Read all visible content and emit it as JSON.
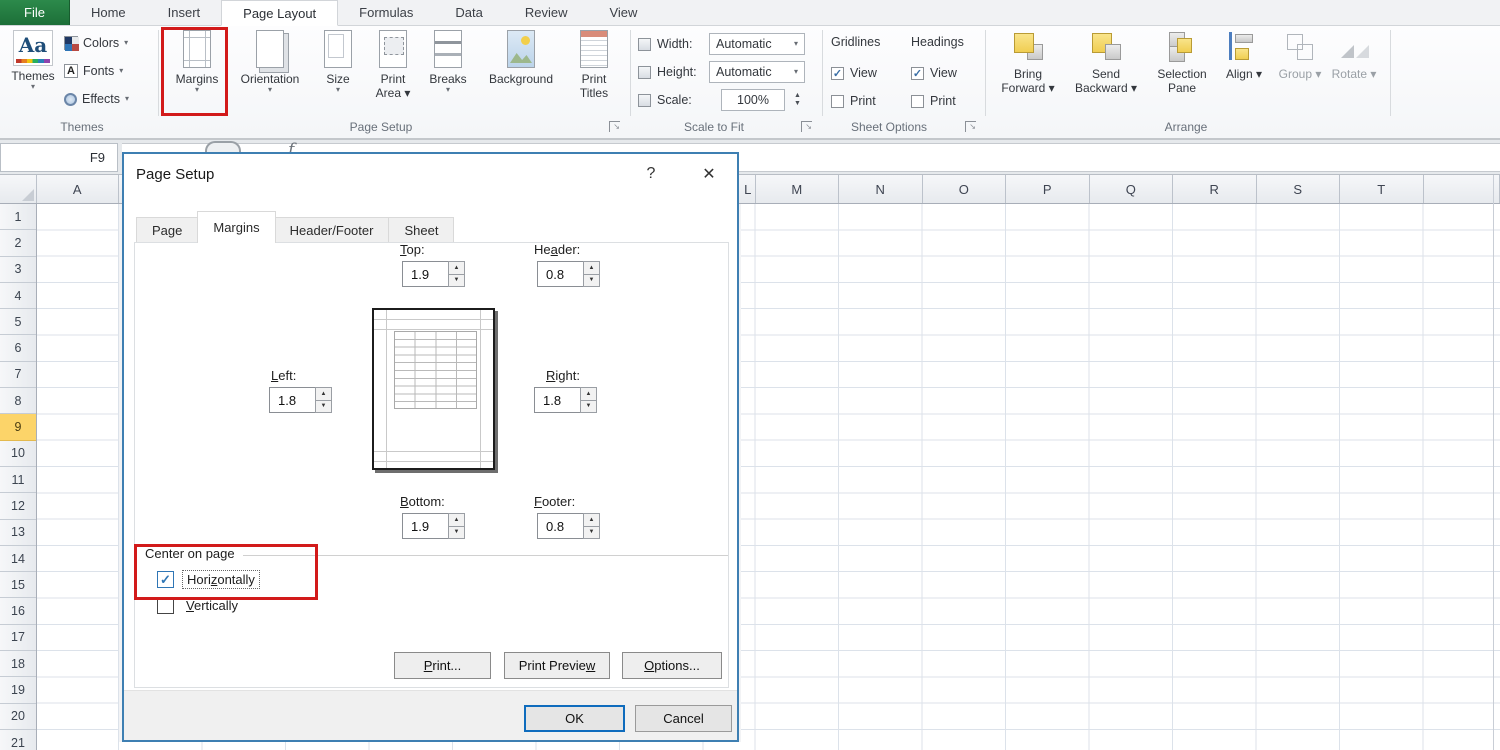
{
  "ribbon": {
    "tabs": [
      {
        "id": "file",
        "label": "File",
        "active": false
      },
      {
        "id": "home",
        "label": "Home",
        "active": false
      },
      {
        "id": "insert",
        "label": "Insert",
        "active": false
      },
      {
        "id": "page-layout",
        "label": "Page Layout",
        "active": true
      },
      {
        "id": "formulas",
        "label": "Formulas",
        "active": false
      },
      {
        "id": "data",
        "label": "Data",
        "active": false
      },
      {
        "id": "review",
        "label": "Review",
        "active": false
      },
      {
        "id": "view",
        "label": "View",
        "active": false
      }
    ],
    "themes": {
      "group_label": "Themes",
      "big_button": "Themes",
      "items": [
        {
          "id": "colors",
          "label": "Colors"
        },
        {
          "id": "fonts",
          "label": "Fonts"
        },
        {
          "id": "effects",
          "label": "Effects"
        }
      ]
    },
    "page_setup": {
      "group_label": "Page Setup",
      "buttons": [
        {
          "id": "margins",
          "lines": [
            "Margins"
          ],
          "caret": "below"
        },
        {
          "id": "orientation",
          "lines": [
            "Orientation"
          ],
          "caret": "below"
        },
        {
          "id": "size",
          "lines": [
            "Size"
          ],
          "caret": "below"
        },
        {
          "id": "print-area",
          "lines": [
            "Print",
            "Area"
          ],
          "caret": "inline"
        },
        {
          "id": "breaks",
          "lines": [
            "Breaks"
          ],
          "caret": "below"
        },
        {
          "id": "background",
          "lines": [
            "Background"
          ],
          "caret": "none"
        },
        {
          "id": "print-titles",
          "lines": [
            "Print",
            "Titles"
          ],
          "caret": "none"
        }
      ]
    },
    "scale_to_fit": {
      "group_label": "Scale to Fit",
      "rows": [
        {
          "id": "width",
          "label": "Width:",
          "value": "Automatic",
          "control": "dropdown"
        },
        {
          "id": "height",
          "label": "Height:",
          "value": "Automatic",
          "control": "dropdown"
        },
        {
          "id": "scale",
          "label": "Scale:",
          "value": "100%",
          "control": "spinner"
        }
      ]
    },
    "sheet_options": {
      "group_label": "Sheet Options",
      "columns": [
        {
          "id": "gridlines",
          "header": "Gridlines",
          "view": {
            "label": "View",
            "checked": true
          },
          "print": {
            "label": "Print",
            "checked": false
          }
        },
        {
          "id": "headings",
          "header": "Headings",
          "view": {
            "label": "View",
            "checked": true
          },
          "print": {
            "label": "Print",
            "checked": false
          }
        }
      ]
    },
    "arrange": {
      "group_label": "Arrange",
      "buttons": [
        {
          "id": "bring-forward",
          "lines": [
            "Bring",
            "Forward"
          ],
          "caret": true,
          "disabled": false
        },
        {
          "id": "send-backward",
          "lines": [
            "Send",
            "Backward"
          ],
          "caret": true,
          "disabled": false
        },
        {
          "id": "selection-pane",
          "lines": [
            "Selection",
            "Pane"
          ],
          "caret": false,
          "disabled": false
        },
        {
          "id": "align",
          "lines": [
            "Align"
          ],
          "caret": true,
          "disabled": false
        },
        {
          "id": "group",
          "lines": [
            "Group"
          ],
          "caret": true,
          "disabled": true
        },
        {
          "id": "rotate",
          "lines": [
            "Rotate"
          ],
          "caret": true,
          "disabled": true
        }
      ]
    }
  },
  "formula_bar": {
    "name_box_value": "F9"
  },
  "grid": {
    "col_a": "A",
    "right_columns": [
      "L",
      "M",
      "N",
      "O",
      "P",
      "Q",
      "R",
      "S",
      "T"
    ],
    "rows": [
      "1",
      "2",
      "3",
      "4",
      "5",
      "6",
      "7",
      "8",
      "9",
      "10",
      "11",
      "12",
      "13",
      "14",
      "15",
      "16",
      "17",
      "18",
      "19",
      "20",
      "21"
    ],
    "selected_row": "9"
  },
  "dialog": {
    "title": "Page Setup",
    "help": "?",
    "close": "✕",
    "tabs": [
      {
        "label": "Page",
        "active": false
      },
      {
        "label": "Margins",
        "active": true
      },
      {
        "label": "Header/Footer",
        "active": false
      },
      {
        "label": "Sheet",
        "active": false
      }
    ],
    "fields": {
      "top": {
        "pre": "",
        "key": "T",
        "post": "op:",
        "value": "1.9"
      },
      "header": {
        "pre": "He",
        "key": "a",
        "post": "der:",
        "value": "0.8"
      },
      "left": {
        "pre": "",
        "key": "L",
        "post": "eft:",
        "value": "1.8"
      },
      "right": {
        "pre": "",
        "key": "R",
        "post": "ight:",
        "value": "1.8"
      },
      "bottom": {
        "pre": "",
        "key": "B",
        "post": "ottom:",
        "value": "1.9"
      },
      "footer": {
        "pre": "",
        "key": "F",
        "post": "ooter:",
        "value": "0.8"
      }
    },
    "center_on_page": {
      "legend": "Center on page",
      "horizontally": {
        "pre": "Hori",
        "key": "z",
        "post": "ontally",
        "checked": true
      },
      "vertically": {
        "pre": "",
        "key": "V",
        "post": "ertically",
        "checked": false
      }
    },
    "buttons": {
      "print": {
        "pre": "",
        "key": "P",
        "post": "rint..."
      },
      "preview": {
        "pre": "Print Previe",
        "key": "w",
        "post": ""
      },
      "options": {
        "pre": "",
        "key": "O",
        "post": "ptions..."
      },
      "ok": "OK",
      "cancel": "Cancel"
    }
  },
  "colors": {
    "annotation_red": "#d21a1a",
    "file_tab_green": "#237b3f",
    "dialog_border": "#3e7fb2",
    "selected_row_fill": "#fcd469",
    "default_button_border": "#0f6cbd",
    "checkbox_blue": "#2f76b5"
  }
}
